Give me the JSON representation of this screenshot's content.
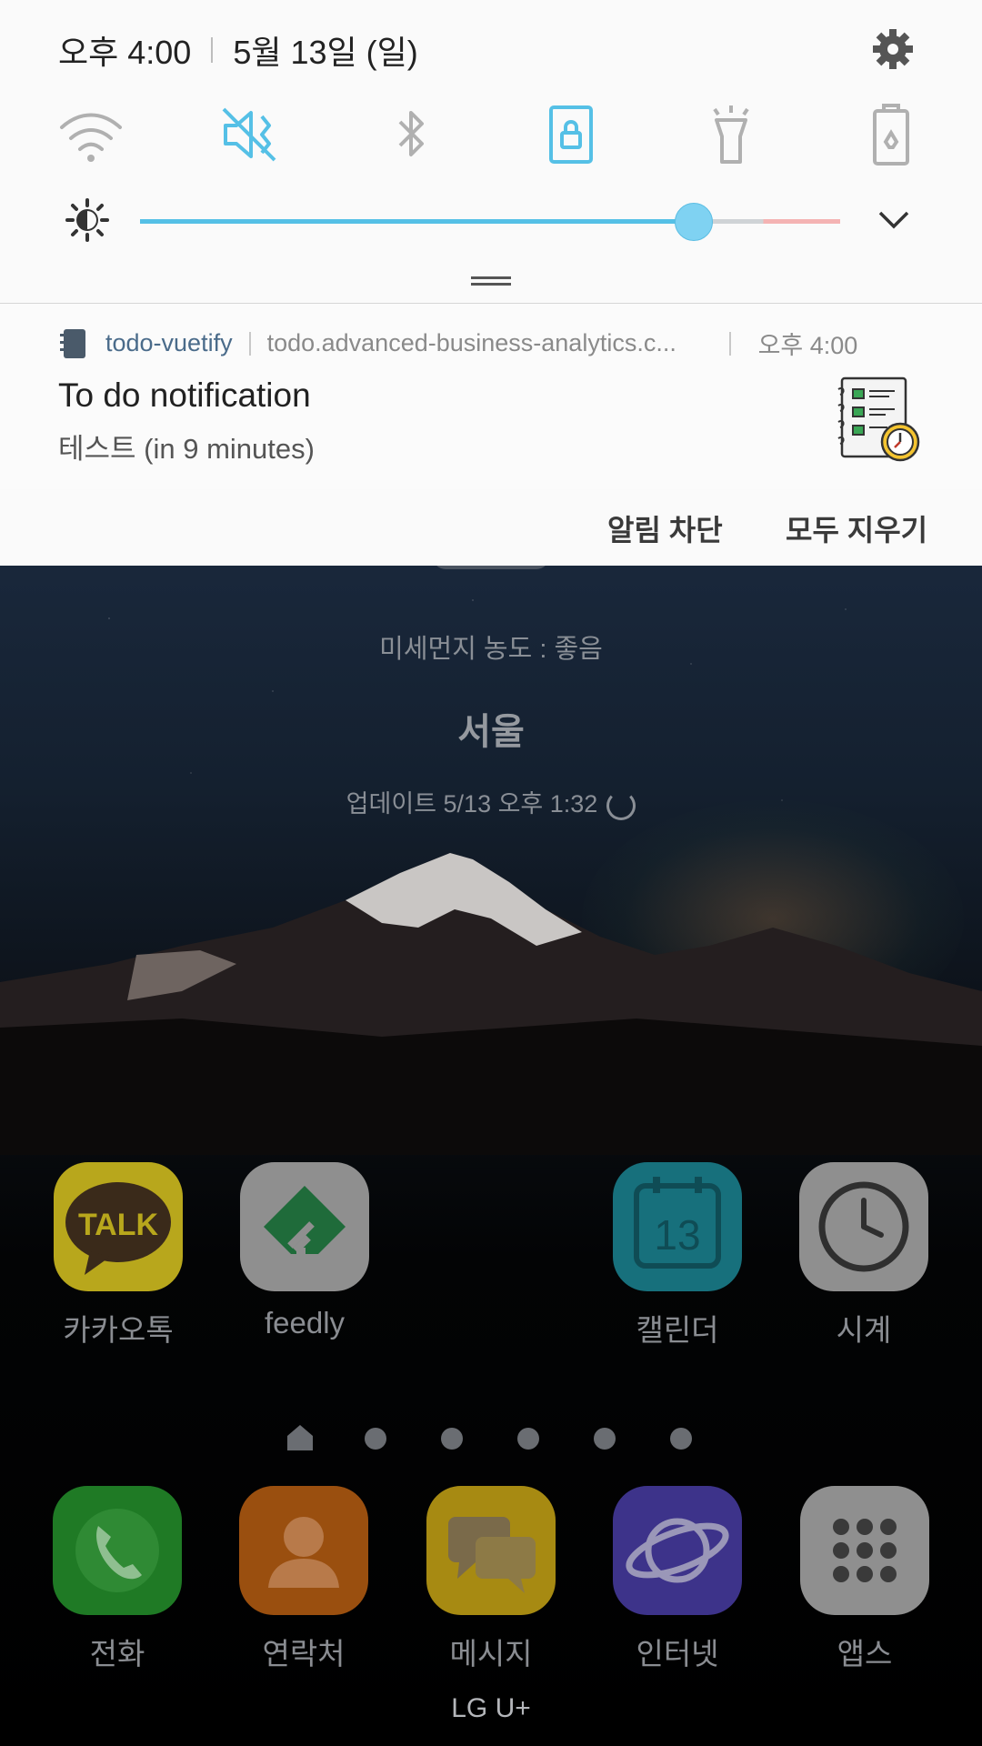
{
  "status": {
    "time": "오후 4:00",
    "date": "5월 13일 (일)"
  },
  "quick_settings": {
    "icons": [
      "wifi-icon",
      "mute-icon",
      "bluetooth-icon",
      "rotation-lock-icon",
      "flashlight-icon",
      "power-saving-icon"
    ],
    "active": [
      "mute-icon",
      "rotation-lock-icon"
    ],
    "accent_color": "#55c0e6"
  },
  "brightness": {
    "level": 0.79
  },
  "notification": {
    "app_name": "todo-vuetify",
    "domain": "todo.advanced-business-analytics.c...",
    "time": "오후 4:00",
    "title": "To do notification",
    "body": "테스트 (in 9 minutes)"
  },
  "actions": {
    "block": "알림 차단",
    "clear_all": "모두 지우기"
  },
  "widget": {
    "dust": "미세먼지 농도 : 좋음",
    "city": "서울",
    "updated": "업데이트 5/13 오후 1:32"
  },
  "apps_row": [
    {
      "label": "카카오톡",
      "icon_text": "TALK"
    },
    {
      "label": "feedly"
    },
    {
      "label": "캘린더",
      "icon_text": "13"
    },
    {
      "label": "시계"
    }
  ],
  "dock": [
    {
      "label": "전화"
    },
    {
      "label": "연락처"
    },
    {
      "label": "메시지"
    },
    {
      "label": "인터넷"
    },
    {
      "label": "앱스"
    }
  ],
  "page_indicator": {
    "pages": 6,
    "current": 0
  },
  "carrier": "LG U+"
}
